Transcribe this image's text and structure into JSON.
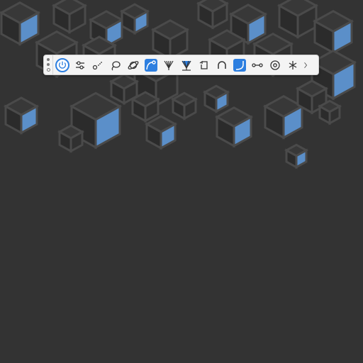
{
  "colors": {
    "background": "#333333",
    "cube_edge": "#4a4a4a",
    "cube_face_dark": "#2b2b2b",
    "cube_face_accent": "#5b8fc9",
    "toolbar_bg": "#f4f4f4",
    "active": "#2d7fe0",
    "icon": "#333333"
  },
  "toolbar": {
    "tools": [
      {
        "icon": "power-icon",
        "state": "selected"
      },
      {
        "icon": "sliders-icon",
        "state": "normal"
      },
      {
        "icon": "node-dots-icon",
        "state": "normal"
      },
      {
        "icon": "lasso-icon",
        "state": "normal"
      },
      {
        "icon": "orbit-icon",
        "state": "normal"
      },
      {
        "icon": "curve-node-icon",
        "state": "active"
      },
      {
        "icon": "fan-brush-icon",
        "state": "normal"
      },
      {
        "icon": "fan-brush-filled-icon",
        "state": "active"
      },
      {
        "icon": "rotate-square-icon",
        "state": "normal"
      },
      {
        "icon": "arch-icon",
        "state": "normal"
      },
      {
        "icon": "curve-corner-icon",
        "state": "active"
      },
      {
        "icon": "link-nodes-icon",
        "state": "normal"
      },
      {
        "icon": "target-ring-icon",
        "state": "normal"
      },
      {
        "icon": "asterisk-icon",
        "state": "normal"
      }
    ],
    "overflow_icon": "chevron-right-icon"
  }
}
